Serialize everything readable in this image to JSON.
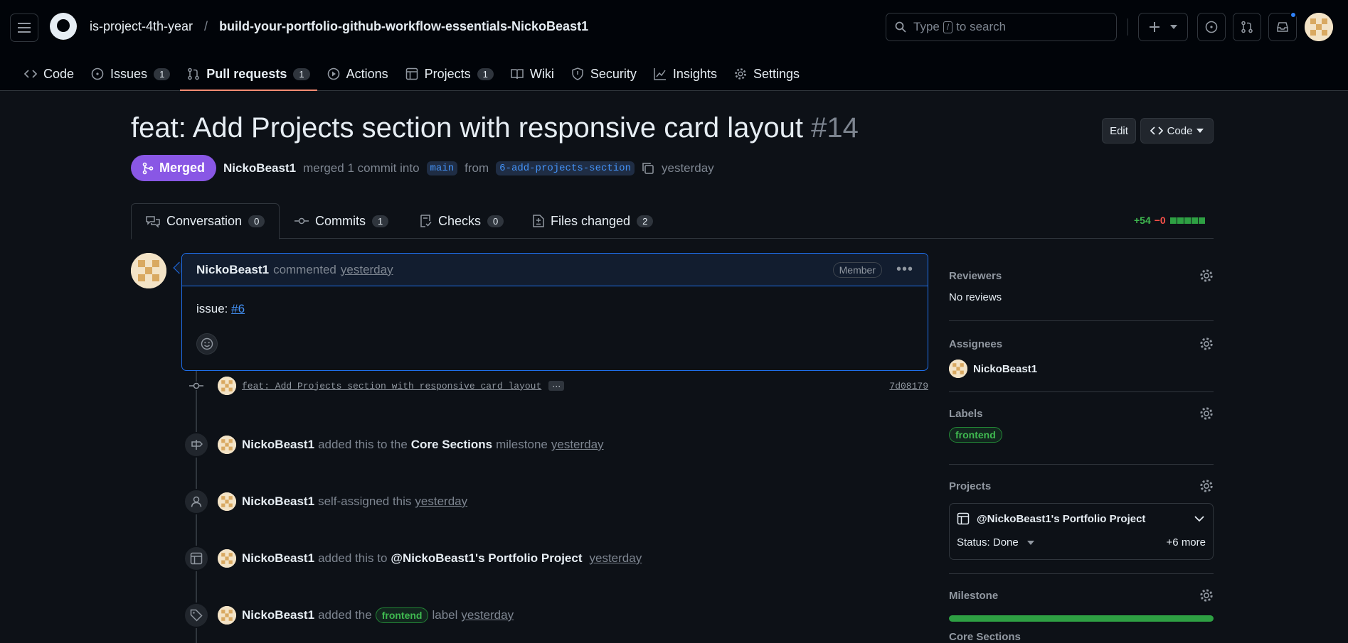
{
  "header": {
    "org": "is-project-4th-year",
    "separator": "/",
    "repo": "build-your-portfolio-github-workflow-essentials-NickoBeast1",
    "search_pre": "Type",
    "search_kbd": "/",
    "search_post": "to search"
  },
  "repo_tabs": [
    {
      "label": "Code"
    },
    {
      "label": "Issues",
      "count": "1"
    },
    {
      "label": "Pull requests",
      "count": "1"
    },
    {
      "label": "Actions"
    },
    {
      "label": "Projects",
      "count": "1"
    },
    {
      "label": "Wiki"
    },
    {
      "label": "Security"
    },
    {
      "label": "Insights"
    },
    {
      "label": "Settings"
    }
  ],
  "pr": {
    "title": "feat: Add Projects section with responsive card layout",
    "number": "#14",
    "edit_label": "Edit",
    "code_label": "Code",
    "state": "Merged",
    "author": "NickoBeast1",
    "merge_text": "merged 1 commit into",
    "base": "main",
    "from_text": "from",
    "head": "6-add-projects-section",
    "time": "yesterday"
  },
  "pr_tabs": [
    {
      "label": "Conversation",
      "count": "0"
    },
    {
      "label": "Commits",
      "count": "1"
    },
    {
      "label": "Checks",
      "count": "0"
    },
    {
      "label": "Files changed",
      "count": "2"
    }
  ],
  "diffstat": {
    "additions": "+54",
    "deletions": "−0"
  },
  "comment": {
    "author": "NickoBeast1",
    "verb": "commented",
    "time": "yesterday",
    "role": "Member",
    "body_prefix": "issue:",
    "body_link": "#6"
  },
  "commit": {
    "message": "feat: Add Projects section with responsive card layout",
    "sha": "7d08179"
  },
  "timeline": [
    {
      "user": "NickoBeast1",
      "text": "added this to the",
      "target": "Core Sections",
      "suffix": "milestone",
      "time": "yesterday"
    },
    {
      "user": "NickoBeast1",
      "text": "self-assigned this",
      "time": "yesterday"
    },
    {
      "user": "NickoBeast1",
      "text": "added this to",
      "target": "@NickoBeast1's Portfolio Project",
      "time": "yesterday"
    },
    {
      "user": "NickoBeast1",
      "text": "added the",
      "label": "frontend",
      "suffix": "label",
      "time": "yesterday"
    }
  ],
  "sidebar": {
    "reviewers_title": "Reviewers",
    "reviewers_value": "No reviews",
    "assignees_title": "Assignees",
    "assignee": "NickoBeast1",
    "labels_title": "Labels",
    "label": "frontend",
    "projects_title": "Projects",
    "project_name": "@NickoBeast1's Portfolio Project",
    "project_status": "Status: Done",
    "project_more": "+6 more",
    "milestone_title": "Milestone",
    "milestone_name": "Core Sections",
    "milestone_progress": 1.0
  }
}
